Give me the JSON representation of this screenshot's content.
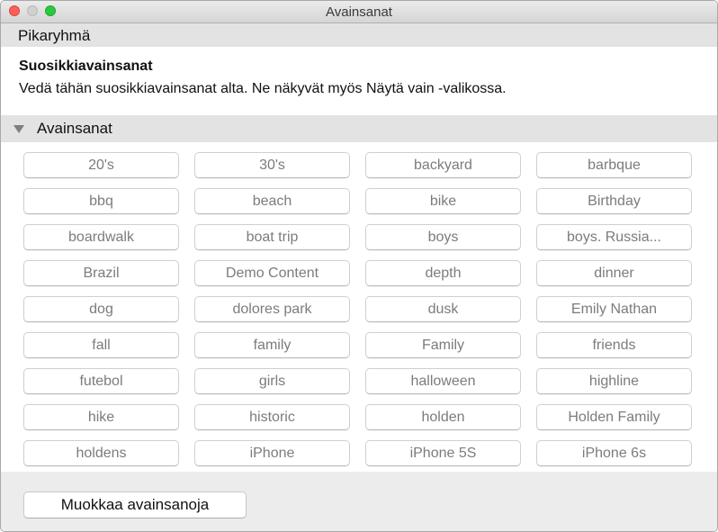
{
  "window": {
    "title": "Avainsanat"
  },
  "quick_group": {
    "label": "Pikaryhmä"
  },
  "favorites": {
    "heading": "Suosikkiavainsanat",
    "description": "Vedä tähän suosikkiavainsanat alta. Ne näkyvät myös Näytä vain -valikossa."
  },
  "keywords_section": {
    "label": "Avainsanat",
    "expanded": true,
    "items": [
      "20's",
      "30's",
      "backyard",
      "barbque",
      "bbq",
      "beach",
      "bike",
      "Birthday",
      "boardwalk",
      "boat trip",
      "boys",
      "boys. Russia...",
      "Brazil",
      "Demo Content",
      "depth",
      "dinner",
      "dog",
      "dolores park",
      "dusk",
      "Emily Nathan",
      "fall",
      "family",
      "Family",
      "friends",
      "futebol",
      "girls",
      "halloween",
      "highline",
      "hike",
      "historic",
      "holden",
      "Holden Family",
      "holdens",
      "iPhone",
      "iPhone 5S",
      "iPhone 6s"
    ]
  },
  "footer": {
    "edit_button_label": "Muokkaa avainsanoja"
  }
}
